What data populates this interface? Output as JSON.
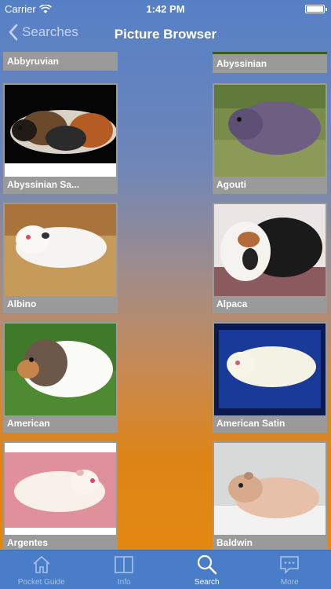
{
  "status": {
    "carrier": "Carrier",
    "time": "1:42 PM"
  },
  "nav": {
    "back_label": "Searches",
    "title": "Picture Browser"
  },
  "breeds": [
    "Abbyruvian",
    "Abyssinian",
    "Abyssinian Sa...",
    "Agouti",
    "Albino",
    "Alpaca",
    "American",
    "American Satin",
    "Argentes",
    "Baldwin"
  ],
  "tabs": [
    {
      "label": "Pocket Guide",
      "icon": "house-icon"
    },
    {
      "label": "Info",
      "icon": "book-icon"
    },
    {
      "label": "Search",
      "icon": "magnifier-icon"
    },
    {
      "label": "More",
      "icon": "chat-bubble-icon"
    }
  ],
  "active_tab": "Search"
}
